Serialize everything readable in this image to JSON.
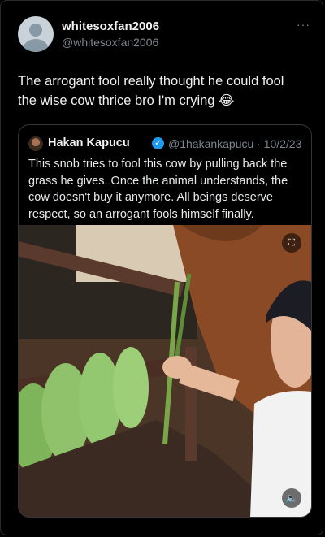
{
  "post": {
    "display_name": "whitesoxfan2006",
    "handle": "@whitesoxfan2006",
    "more_icon": "···",
    "text": "The arrogant fool really thought he could fool the wise cow thrice bro I'm crying 😂"
  },
  "quote": {
    "display_name": "Hakan Kapucu",
    "verified_mark": "✓",
    "handle_date": "@1hakankapucu · 10/2/23",
    "text": "This snob tries to fool this cow by pulling back the grass he gives. Once the animal understands, the cow doesn't buy it anymore. All beings deserve respect, so an arrogant fools himself finally."
  },
  "media": {
    "fullscreen_icon": "⛶",
    "mute_icon": "🔈"
  },
  "colors": {
    "background": "#000000",
    "text": "#e7e9ea",
    "secondary": "#7d858d",
    "verified": "#1d9bf0",
    "border": "#333639"
  }
}
